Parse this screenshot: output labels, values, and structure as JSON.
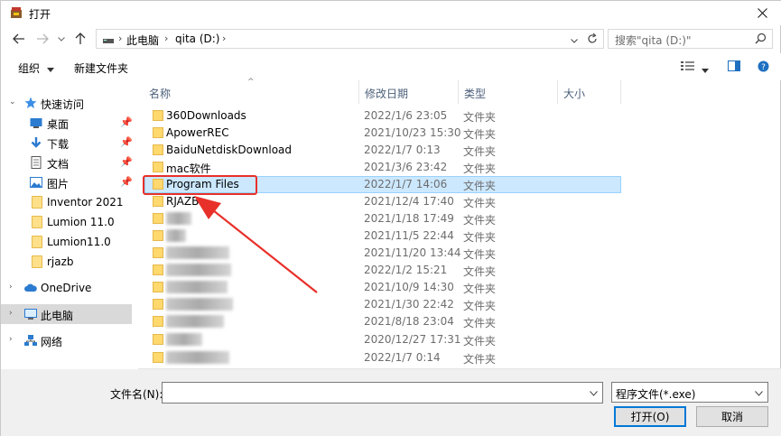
{
  "window": {
    "title": "打开"
  },
  "address": {
    "crumbs": [
      "此电脑",
      "qita (D:)"
    ]
  },
  "search": {
    "placeholder": "搜索\"qita (D:)\""
  },
  "toolbar": {
    "organize": "组织",
    "new_folder": "新建文件夹"
  },
  "nav": {
    "quick_access": "快速访问",
    "pinned": [
      {
        "label": "桌面",
        "icon": "desktop-icon"
      },
      {
        "label": "下载",
        "icon": "download-icon"
      },
      {
        "label": "文档",
        "icon": "document-icon"
      },
      {
        "label": "图片",
        "icon": "picture-icon"
      }
    ],
    "folders": [
      "Inventor 2021",
      "Lumion 11.0",
      "Lumion11.0",
      "rjazb"
    ],
    "onedrive": "OneDrive",
    "this_pc": "此电脑",
    "network": "网络"
  },
  "columns": {
    "name": "名称",
    "date": "修改日期",
    "type": "类型",
    "size": "大小"
  },
  "files": [
    {
      "name": "360Downloads",
      "date": "2022/1/6 23:05",
      "type": "文件夹"
    },
    {
      "name": "ApowerREC",
      "date": "2021/10/23 15:30",
      "type": "文件夹"
    },
    {
      "name": "BaiduNetdiskDownload",
      "date": "2022/1/7 0:13",
      "type": "文件夹"
    },
    {
      "name": "mac软件",
      "date": "2021/3/6 23:42",
      "type": "文件夹"
    },
    {
      "name": "Program Files",
      "date": "2022/1/7 14:06",
      "type": "文件夹",
      "selected": true
    },
    {
      "name": "RJAZB",
      "date": "2021/12/4 17:40",
      "type": "文件夹"
    },
    {
      "name": "",
      "date": "2021/1/18 17:49",
      "type": "文件夹",
      "blurred": true
    },
    {
      "name": "",
      "date": "2021/11/5 22:44",
      "type": "文件夹",
      "blurred": true
    },
    {
      "name": "",
      "date": "2021/11/20 13:44",
      "type": "文件夹",
      "blurred": true
    },
    {
      "name": "",
      "date": "2022/1/2 15:21",
      "type": "文件夹",
      "blurred": true
    },
    {
      "name": "",
      "date": "2021/10/9 14:30",
      "type": "文件夹",
      "blurred": true
    },
    {
      "name": "",
      "date": "2021/1/30 22:42",
      "type": "文件夹",
      "blurred": true
    },
    {
      "name": "",
      "date": "2021/8/18 23:04",
      "type": "文件夹",
      "blurred": true
    },
    {
      "name": "",
      "date": "2020/12/27 17:31",
      "type": "文件夹",
      "blurred": true
    },
    {
      "name": "",
      "date": "2022/1/7 0:14",
      "type": "文件夹",
      "blurred": true
    }
  ],
  "bottom": {
    "filename_label": "文件名(N):",
    "filename_value": "",
    "filter_value": "程序文件(*.exe)",
    "open_button": "打开(O)",
    "cancel_button": "取消"
  },
  "colors": {
    "annotation": "#e8302a",
    "selection": "#cce8ff",
    "accent": "#0078d7"
  }
}
